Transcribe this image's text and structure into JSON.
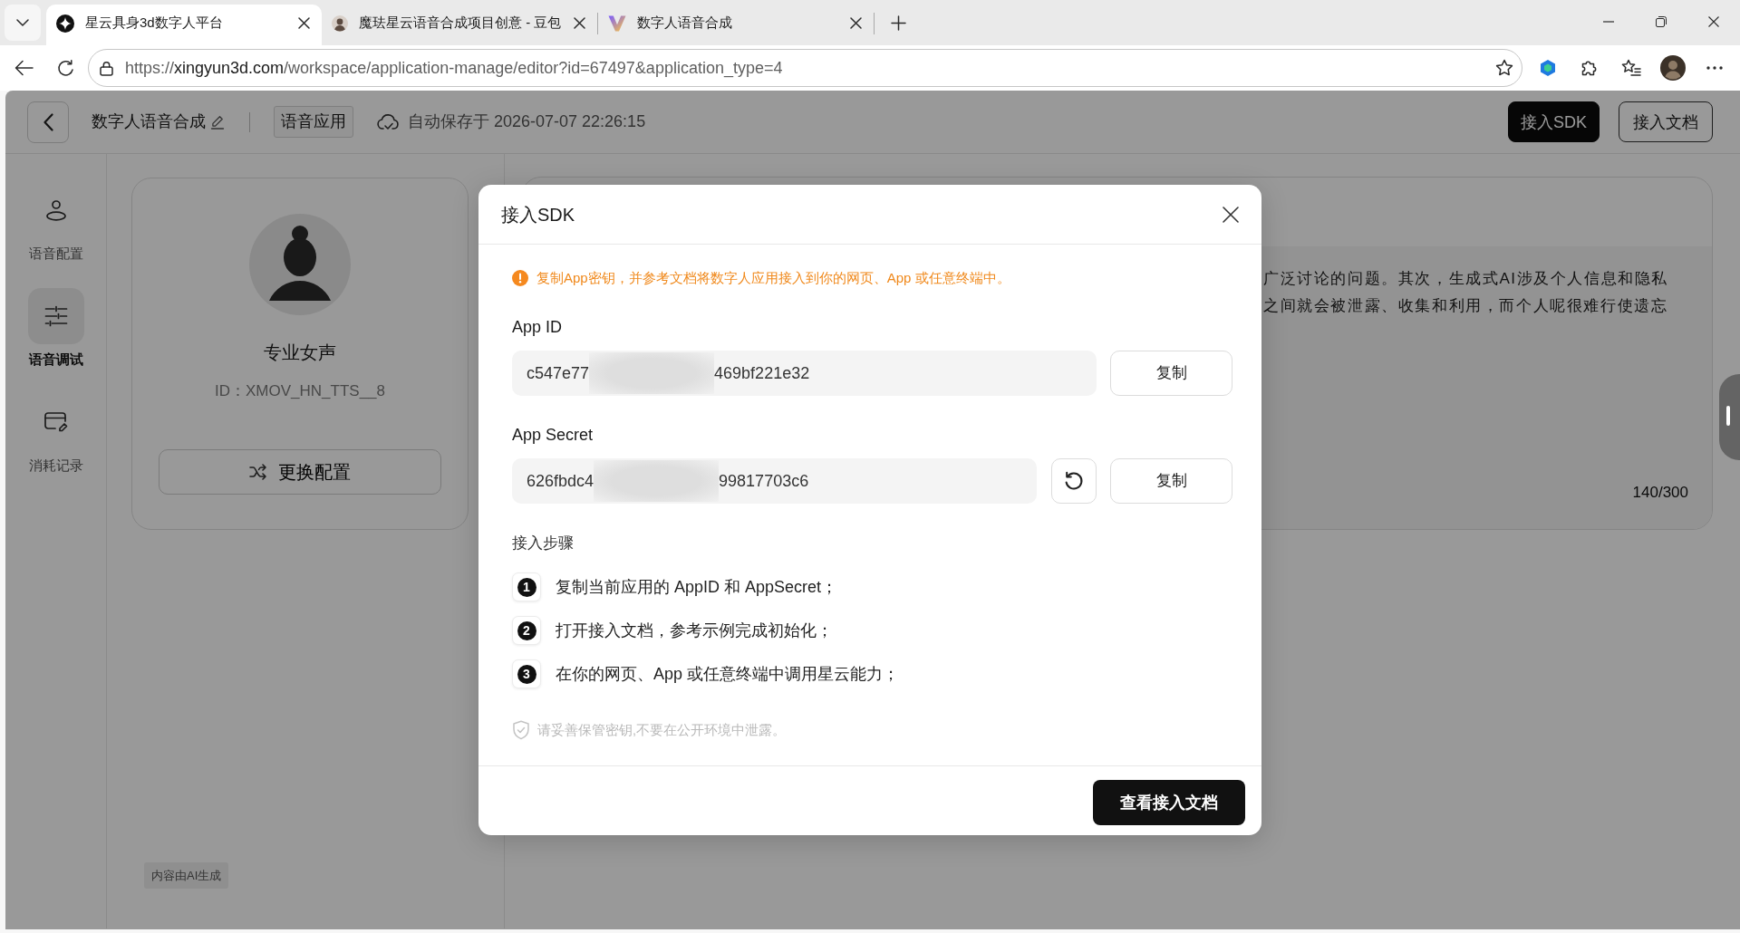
{
  "browser": {
    "tabs": [
      {
        "title": "星云具身3d数字人平台",
        "selected": true
      },
      {
        "title": "魔珐星云语音合成项目创意 - 豆包",
        "selected": false
      },
      {
        "title": "数字人语音合成",
        "selected": false
      }
    ],
    "address": {
      "scheme": "https://",
      "host": "xingyun3d.com",
      "path": "/workspace/application-manage/editor?id=67497&application_type=4"
    }
  },
  "header": {
    "title": "数字人语音合成",
    "tag": "语音应用",
    "autosave": "自动保存于 2026-07-07 22:26:15",
    "buttons": [
      {
        "label": "接入SDK",
        "kind": "primary"
      },
      {
        "label": "接入文档",
        "kind": "outline"
      }
    ]
  },
  "sidebar": {
    "items": [
      {
        "label": "语音配置",
        "selected": false
      },
      {
        "label": "语音调试",
        "selected": true
      },
      {
        "label": "消耗记录",
        "selected": false
      }
    ]
  },
  "voice_card": {
    "name": "专业女声",
    "id": "ID：XMOV_HN_TTS__8",
    "button": "更换配置"
  },
  "ai_notice": "内容由AI生成",
  "text_panel": {
    "lines": [
      "广泛讨论的问题。其次，生成式AI涉及个人信息和隐私",
      "之间就会被泄露、收集和利用，而个人呢很难行使遗忘"
    ],
    "count": "140/300"
  },
  "dialog": {
    "title": "接入SDK",
    "notice": "复制App密钥，并参考文档将数字人应用接入到你的网页、App 或任意终端中。",
    "fields": [
      {
        "label": "App ID",
        "value_start": "c547e77",
        "value_end": "469bf221e32",
        "reset_button": false,
        "copy_button": "复制"
      },
      {
        "label": "App Secret",
        "value_start": "626fbdc4",
        "value_end": "99817703c6",
        "reset_button": true,
        "copy_button": "复制"
      }
    ],
    "steps_title": "接入步骤",
    "steps": [
      {
        "number": "1",
        "text": "复制当前应用的 AppID 和 AppSecret；"
      },
      {
        "number": "2",
        "text": "打开接入文档，参考示例完成初始化；"
      },
      {
        "number": "3",
        "text": "在你的网页、App 或任意终端中调用星云能力；"
      }
    ],
    "security_note": "请妥善保管密钥,不要在公开环境中泄露。",
    "footer_button": "查看接入文档"
  }
}
